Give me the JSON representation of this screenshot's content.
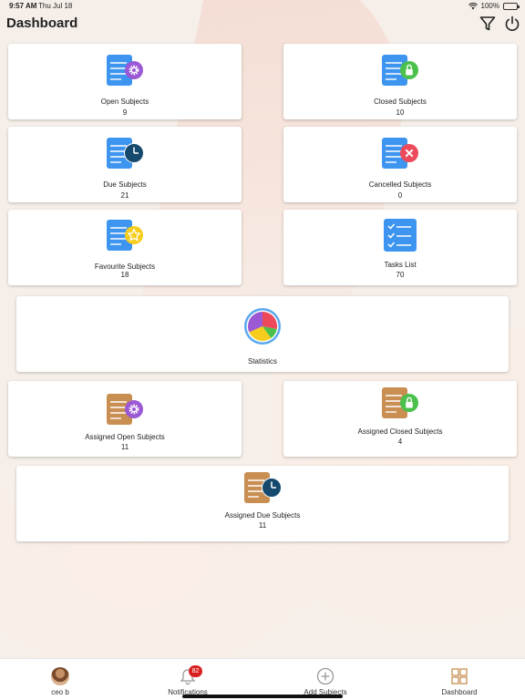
{
  "status_bar": {
    "time": "9:57 AM",
    "date": "Thu Jul 18",
    "battery": "100%"
  },
  "header": {
    "title": "Dashboard",
    "filter_icon": "filter-icon",
    "power_icon": "power-icon"
  },
  "cards": {
    "open_subjects": {
      "label": "Open Subjects",
      "count": "9"
    },
    "closed_subjects": {
      "label": "Closed Subjects",
      "count": "10"
    },
    "due_subjects": {
      "label": "Due Subjects",
      "count": "21"
    },
    "cancelled_subjects": {
      "label": "Cancelled Subjects",
      "count": "0"
    },
    "favourite_subjects": {
      "label": "Favourite Subjects",
      "count": "18"
    },
    "tasks_list": {
      "label": "Tasks List",
      "count": "70"
    },
    "statistics": {
      "label": "Statistics"
    },
    "assigned_open_subjects": {
      "label": "Assigned Open Subjects",
      "count": "11"
    },
    "assigned_closed_subjects": {
      "label": "Assigned Closed Subjects",
      "count": "4"
    },
    "assigned_due_subjects": {
      "label": "Assigned Due Subjects",
      "count": "11"
    }
  },
  "tab_bar": {
    "profile": "ceo b",
    "notifications": "Notifications",
    "notifications_badge": "82",
    "add_subjects": "Add Subjects",
    "dashboard": "Dashboard"
  },
  "colors": {
    "doc_blue": "#3d95f0",
    "doc_tan": "#c98e52",
    "gear_purple": "#9b59d6",
    "lock_green": "#4cc04c",
    "clock_navy": "#154a6e",
    "cancel_red": "#ec4a5a",
    "star_yellow": "#f7cd1d"
  }
}
